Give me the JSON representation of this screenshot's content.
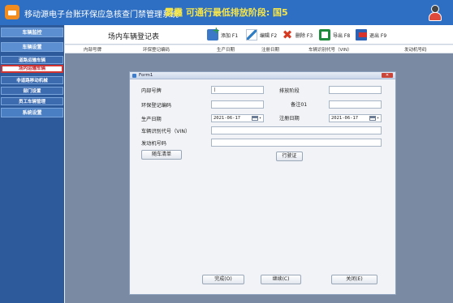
{
  "app": {
    "title": "移动源电子台账环保应急核查门禁管理系统",
    "banner": "雾霾 可通行最低排放阶段: 国5"
  },
  "sidebar": {
    "items": [
      {
        "label": "车辆监控"
      },
      {
        "label": "车辆设置"
      },
      {
        "label": "道路运输车辆"
      },
      {
        "label": "场内运输车辆"
      },
      {
        "label": "非道路移动机械"
      },
      {
        "label": "部门设置"
      },
      {
        "label": "员工车辆管理"
      },
      {
        "label": "系统设置"
      }
    ]
  },
  "page": {
    "title": "场内车辆登记表"
  },
  "toolbar": {
    "add": "添加 F1",
    "edit": "编辑 F2",
    "delete": "删除 F3",
    "export": "导出 F8",
    "exit": "退出 F9"
  },
  "grid": {
    "columns": [
      "内部号牌",
      "环保登记编码",
      "生产日期",
      "注册日期",
      "车辆识别代号（VIN）",
      "发动机号码"
    ]
  },
  "form": {
    "title": "Form1",
    "close": "✕",
    "labels": {
      "internal_plate": "内部号牌",
      "emission_stage": "排放阶段",
      "env_code": "环保登记编码",
      "remark": "备注01",
      "production_date": "生产日期",
      "register_date": "注册日期",
      "vin": "车辆识别代号（VIN）",
      "engine_no": "发动机号码"
    },
    "values": {
      "internal_plate": "|",
      "emission_stage": "",
      "env_code": "",
      "remark": "",
      "production_date": "2021-06-17",
      "register_date": "2021-06-17",
      "vin": "",
      "engine_no": ""
    },
    "buttons": {
      "attach_list": "随车清单",
      "driving_license": "行驶证",
      "finish": "完成(O)",
      "continue": "继续(C)",
      "close": "关闭(E)"
    }
  }
}
